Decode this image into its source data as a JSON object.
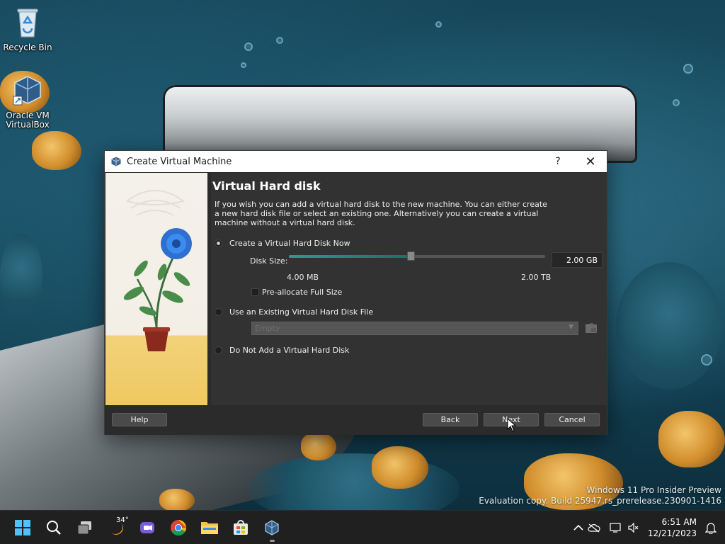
{
  "desktop": {
    "icons": [
      {
        "label": "Recycle Bin",
        "icon": "recycle-bin-icon"
      },
      {
        "label": "Oracle VM VirtualBox",
        "icon": "virtualbox-icon"
      }
    ],
    "watermark": {
      "line1": "Windows 11 Pro Insider Preview",
      "line2": "Evaluation copy. Build 25947.rs_prerelease.230901-1416"
    }
  },
  "dialog": {
    "title": "Create Virtual Machine",
    "help_glyph": "?",
    "close_glyph": "✕",
    "heading": "Virtual Hard disk",
    "description": "If you wish you can add a virtual hard disk to the new machine. You can either create a new hard disk file or select an existing one. Alternatively you can create a virtual machine without a virtual hard disk.",
    "options": {
      "create_now": {
        "label": "Create a Virtual Hard Disk Now",
        "selected": true
      },
      "use_existing": {
        "label": "Use an Existing Virtual Hard Disk File",
        "selected": false
      },
      "do_not_add": {
        "label": "Do Not Add a Virtual Hard Disk",
        "selected": false
      }
    },
    "disk_size": {
      "label": "Disk Size:",
      "value": "2.00 GB",
      "min_label": "4.00 MB",
      "max_label": "2.00 TB",
      "slider_fraction": 0.475
    },
    "preallocate": {
      "label": "Pre-allocate Full Size",
      "checked": false
    },
    "existing_file": {
      "value": "Empty"
    },
    "buttons": {
      "help": "Help",
      "back": "Back",
      "next": "Next",
      "cancel": "Cancel"
    }
  },
  "taskbar": {
    "weather_temp": "34°",
    "apps": [
      "windows-start-icon",
      "search-icon",
      "task-view-icon",
      "weather-icon",
      "teams-icon",
      "chrome-icon",
      "file-explorer-icon",
      "store-icon",
      "virtualbox-icon"
    ],
    "clock": {
      "time": "6:51 AM",
      "date": "12/21/2023"
    }
  },
  "colors": {
    "dialog_bg": "#2b2b2b",
    "content_bg": "#323232",
    "accent": "#2a9d8f",
    "taskbar_bg": "#202020"
  }
}
